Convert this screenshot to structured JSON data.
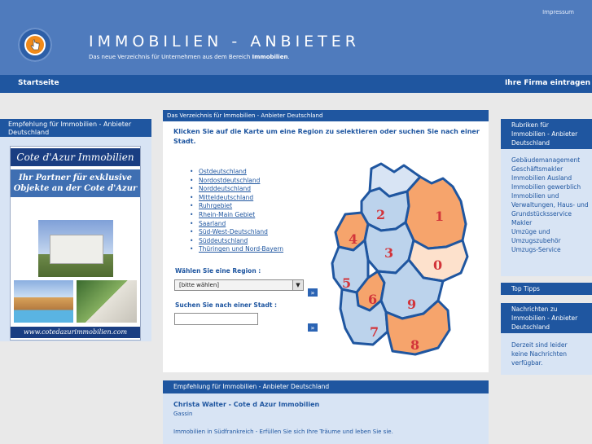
{
  "header": {
    "impressum": "Impressum",
    "title": "IMMOBILIEN - ANBIETER",
    "subtitle_prefix": "Das neue Verzeichnis für Unternehmen aus dem Bereich",
    "subtitle_bold": "Immobilien",
    "subtitle_suffix": "."
  },
  "nav": {
    "home": "Startseite",
    "register": "Ihre Firma eintragen"
  },
  "left": {
    "heading": "Empfehlung für     Immobilien     - Anbieter Deutschland",
    "ad": {
      "title": "Cote d'Azur Immobilien",
      "slogan": "Ihr Partner für exklusive Objekte an der Cote d'Azur",
      "url": "www.cotedazurimmobilien.com"
    }
  },
  "center": {
    "heading": "Das Verzeichnis für Immobilien - Anbieter Deutschland",
    "intro": "Klicken Sie auf die Karte um eine Region zu selektieren oder suchen Sie nach einer Stadt.",
    "regions": [
      "Ostdeutschland",
      "Nordostdeutschland",
      "Norddeutschland",
      "Mitteldeutschland",
      "Ruhrgebiet",
      "Rhein-Main Gebiet",
      "Saarland",
      "Süd-West-Deutschland",
      "Süddeutschland",
      "Thüringen und Nord-Bayern"
    ],
    "region_label": "Wählen Sie eine Region :",
    "region_select_value": "[bitte wählen]",
    "city_label": "Suchen Sie nach einer Stadt :",
    "city_value": "",
    "go_label": "»",
    "map_numbers": [
      "1",
      "2",
      "3",
      "0",
      "4",
      "5",
      "6",
      "9",
      "7",
      "8"
    ]
  },
  "recommendation": {
    "heading": "Empfehlung für     Immobilien     - Anbieter Deutschland",
    "name": "Christa Walter - Cote d Azur Immobilien",
    "city": "Gassin",
    "description": "Immobilien in Südfrankreich - Erfüllen Sie sich Ihre Träume und leben Sie sie."
  },
  "right": {
    "rubriken_heading": "Rubriken für Immobilien - Anbieter Deutschland",
    "rubriken": [
      "Gebäudemanagement",
      "Geschäftsmakler",
      "Immobilien Ausland",
      "Immobilien gewerblich",
      "Immobilien und Verwaltungen, Haus- und Grundstücksservice",
      "Makler",
      "Umzüge und Umzugszubehör",
      "Umzugs-Service"
    ],
    "top_tipps": "Top Tipps",
    "news_heading": "Nachrichten zu Immobilien - Anbieter Deutschland",
    "news_text": "Derzeit sind leider keine Nachrichten verfügbar."
  },
  "colors": {
    "header_blue": "#4f7bbd",
    "nav_blue": "#1f56a0",
    "panel_light": "#d8e4f4",
    "map_orange": "#f6a46c",
    "map_light": "#fde1cc",
    "map_blue": "#bcd3ec"
  }
}
